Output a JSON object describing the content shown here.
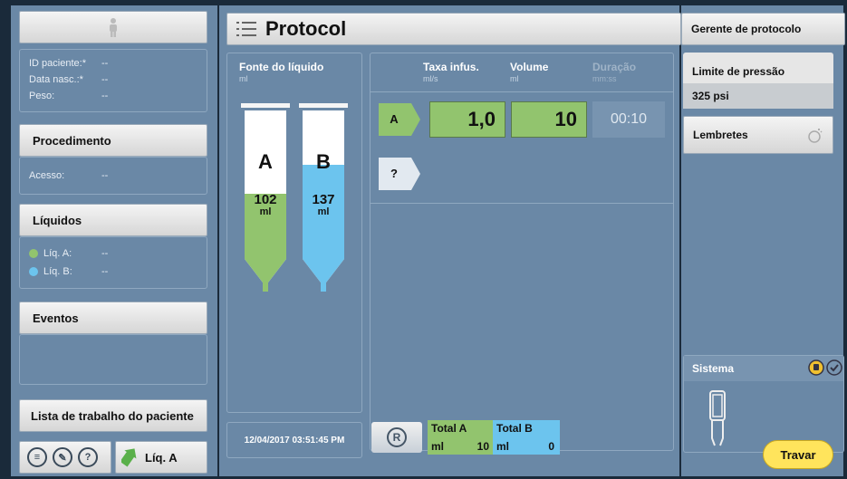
{
  "patient": {
    "id_label": "ID paciente:*",
    "id_value": "--",
    "dob_label": "Data nasc.:*",
    "dob_value": "--",
    "weight_label": "Peso:",
    "weight_value": "--"
  },
  "procedure": {
    "title": "Procedimento",
    "access_label": "Acesso:",
    "access_value": "--"
  },
  "liquids": {
    "title": "Líquidos",
    "a_label": "Líq. A:",
    "a_value": "--",
    "b_label": "Líq. B:",
    "b_value": "--",
    "color_a": "#92c46e",
    "color_b": "#6cc4ee"
  },
  "events": {
    "title": "Eventos"
  },
  "worklist": {
    "label": "Lista de trabalho do paciente"
  },
  "bottom_left": {
    "liq_button": "Líq. A"
  },
  "protocol": {
    "title": "Protocol"
  },
  "fluid_source": {
    "title": "Fonte do líquido",
    "unit": "ml"
  },
  "syringe_a": {
    "letter": "A",
    "volume": "102",
    "unit": "ml",
    "fill_fraction": 0.52
  },
  "syringe_b": {
    "letter": "B",
    "volume": "137",
    "unit": "ml",
    "fill_fraction": 0.7
  },
  "columns": {
    "rate": "Taxa infus.",
    "rate_unit": "ml/s",
    "volume": "Volume",
    "volume_unit": "ml",
    "duration": "Duração",
    "duration_unit": "mm:ss"
  },
  "phase_a": {
    "label": "A",
    "rate": "1,0",
    "volume": "10",
    "duration": "00:10"
  },
  "phase_next": {
    "label": "?"
  },
  "datetime": "12/04/2017 03:51:45 PM",
  "reset_label": "R",
  "totals": {
    "a_title": "Total A",
    "a_unit": "ml",
    "a_value": "10",
    "b_title": "Total B",
    "b_unit": "ml",
    "b_value": "0"
  },
  "right": {
    "manager": "Gerente de protocolo",
    "pressure_label": "Limite de pressão",
    "pressure_value": "325 psi",
    "reminders": "Lembretes",
    "system": "Sistema",
    "lock": "Travar"
  },
  "icons": [
    "person-icon",
    "list-icon",
    "wrench-icon",
    "help-icon",
    "arrow-icon",
    "bell-icon",
    "plug-icon",
    "check-icon",
    "injector-icon",
    "reset-icon"
  ]
}
